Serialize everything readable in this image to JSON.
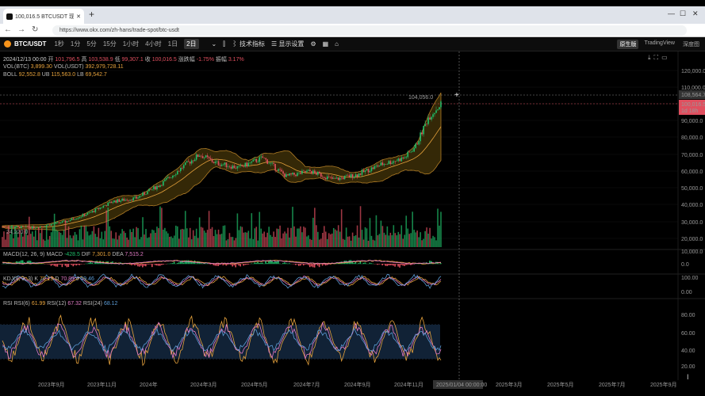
{
  "browser": {
    "tab_title": "100,016.5 BTCUSDT 现货交易 | ...",
    "url": "https://www.okx.com/zh-hans/trade-spot/btc-usdt"
  },
  "toolbar": {
    "pair": "BTC/USDT",
    "timeframes": [
      "1秒",
      "1分",
      "5分",
      "15分",
      "1小时",
      "4小时",
      "1日",
      "2日"
    ],
    "active_timeframe": "2日",
    "indicators_label": "技术指标",
    "display_settings_label": "显示设置",
    "views": [
      "原生版",
      "TradingView",
      "深度图"
    ],
    "active_view": "原生版"
  },
  "legend": {
    "date": "2024/12/13 00:00",
    "open_label": "开",
    "open": "101,796.5",
    "high_label": "高",
    "high": "103,538.9",
    "low_label": "低",
    "low": "99,307.1",
    "close_label": "收",
    "close": "100,016.5",
    "change_label": "涨跌幅",
    "change": "-1.75%",
    "amp_label": "振幅",
    "amp": "3.17%",
    "vol_btc_label": "VOL(BTC)",
    "vol_btc": "3,899.30",
    "vol_usdt_label": "VOL(USDT)",
    "vol_usdt": "392,979,728.11",
    "boll_label": "BOLL",
    "boll": "92,552.8",
    "ub_label": "UB",
    "ub": "115,563.0",
    "lb_label": "LB",
    "lb": "69,542.7"
  },
  "macd": {
    "label": "MACD(12, 26, 9)",
    "macd_label": "MACD",
    "macd": "-428.5",
    "dif_label": "DIF",
    "dif": "7,301.0",
    "dea_label": "DEA",
    "dea": "7,515.2"
  },
  "kdj": {
    "label": "KDJ(9, 3, 3)",
    "k_label": "K",
    "k": "70.19",
    "d_label": "D",
    "d": "70.85",
    "j_label": "J",
    "j": "69.46"
  },
  "rsi": {
    "label": "RSI",
    "r6_label": "RSI(6)",
    "r6": "61.99",
    "r12_label": "RSI(12)",
    "r12": "67.32",
    "r24_label": "RSI(24)",
    "r24": "68.12"
  },
  "price_axis": [
    "120,000.0",
    "110,000.0",
    "100,000.0",
    "90,000.0",
    "80,000.0",
    "70,000.0",
    "60,000.0",
    "50,000.0",
    "40,000.0",
    "30,000.0",
    "20,000.0"
  ],
  "crosshair_price": "108,564.7",
  "last_price": "100,016.5",
  "countdown": "1d 18h",
  "macd_axis": [
    "10,000.0",
    "0.0"
  ],
  "kdj_axis": [
    "100.00",
    "0.00"
  ],
  "rsi_axis": [
    "80.00",
    "60.00",
    "40.00",
    "20.00"
  ],
  "time_axis": [
    "2023年9月",
    "2023年11月",
    "2024年",
    "2024年3月",
    "2024年5月",
    "2024年7月",
    "2024年9月",
    "2024年11月",
    "2025/01/04 00:00:00",
    "2025年3月",
    "2025年5月",
    "2025年7月",
    "2025年9月"
  ],
  "annotations": {
    "max_price": "104,056.0",
    "min_price": "24,220.0"
  },
  "colors": {
    "up": "#1fbf6a",
    "down": "#e04f5f",
    "boll_fill": "#3a2d08",
    "boll_line": "#e6a23c",
    "rsi_band": "#112236"
  }
}
